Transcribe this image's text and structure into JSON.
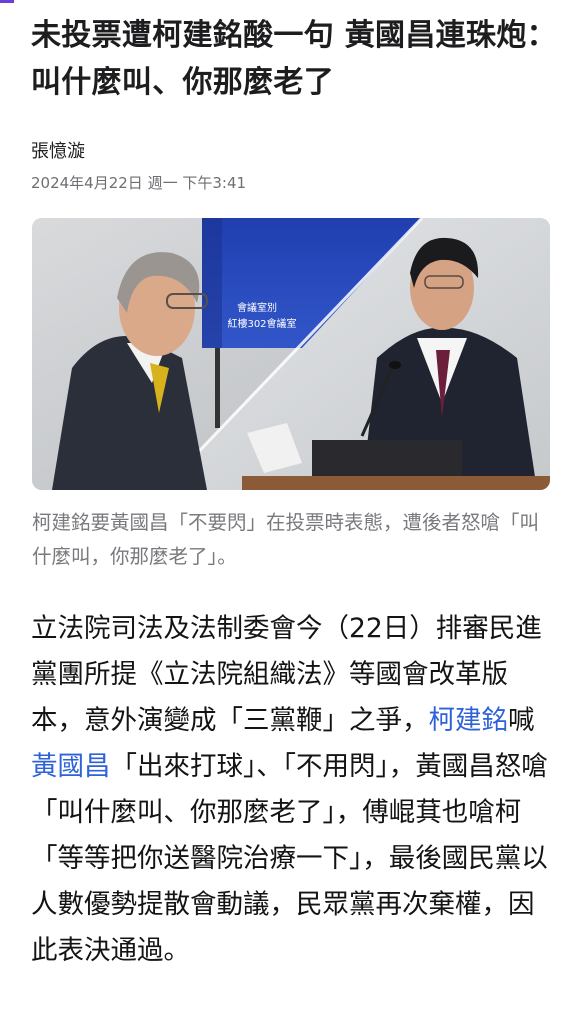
{
  "article": {
    "headline": "未投票遭柯建銘酸一句 黃國昌連珠炮：叫什麼叫、你那麼老了",
    "author": "張憶漩",
    "timestamp": "2024年4月22日 週一 下午3:41",
    "image": {
      "sign_line1": "會議室別",
      "sign_line2": "紅樓302會議室"
    },
    "caption": "柯建銘要黃國昌「不要閃」在投票時表態，遭後者怒嗆「叫什麼叫，你那麼老了」。",
    "body": {
      "seg1": "立法院司法及法制委會今（22日）排審民進黨團所提《立法院組織法》等國會改革版本，意外演變成「三黨鞭」之爭，",
      "link1": "柯建銘",
      "seg2": "喊",
      "link2": "黃國昌",
      "seg3": "「出來打球」、「不用閃」，黃國昌怒嗆「叫什麼叫、你那麼老了」，傅崐萁也嗆柯「等等把你送醫院治療一下」，最後國民黨以人數優勢提散會動議，民眾黨再次棄權，因此表決通過。"
    }
  },
  "colors": {
    "headline": "#1d1d1f",
    "meta": "#6e6e73",
    "caption": "#7a7a7e",
    "link": "#2f62d8",
    "accent": "#6b3fd6"
  }
}
